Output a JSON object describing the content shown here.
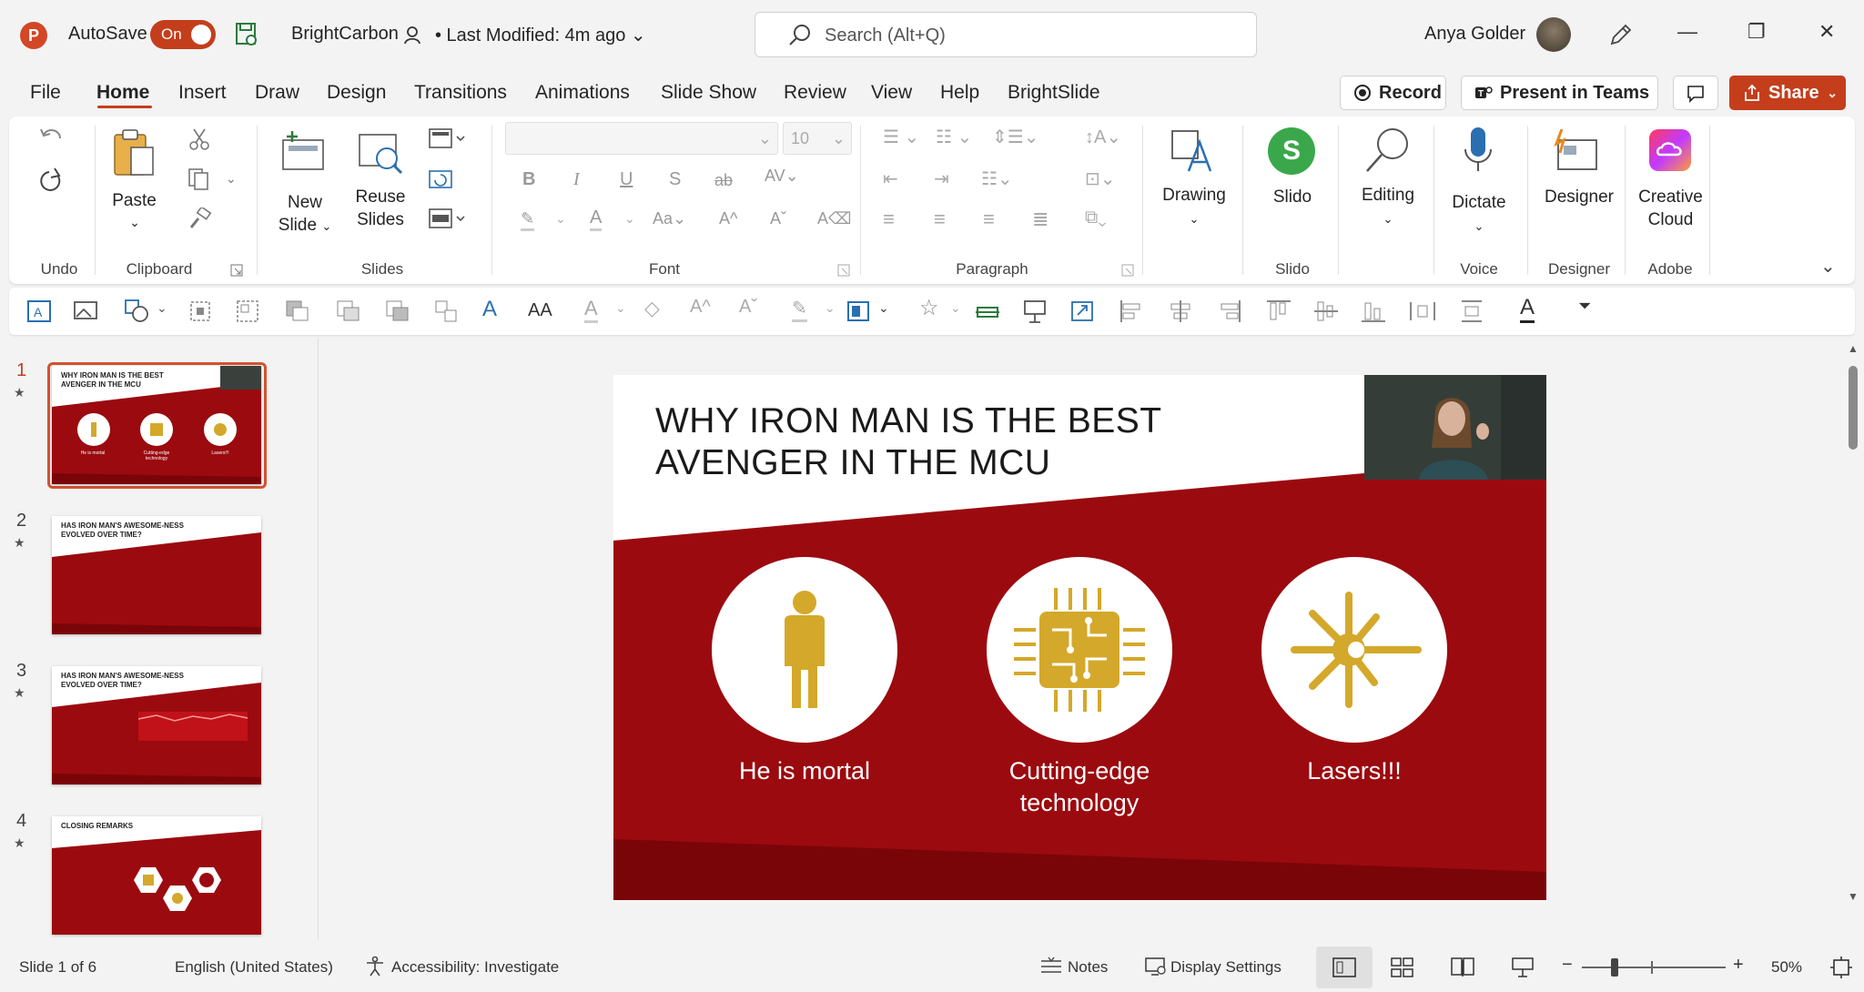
{
  "titlebar": {
    "app_letter": "P",
    "autosave_label": "AutoSave",
    "autosave_state": "On",
    "document_name": "BrightCarbon",
    "modified": "• Last Modified: 4m ago",
    "search_placeholder": "Search (Alt+Q)",
    "user_name": "Anya Golder",
    "minimize": "—",
    "restore": "❐",
    "close": "✕"
  },
  "menu": {
    "tabs": [
      "File",
      "Home",
      "Insert",
      "Draw",
      "Design",
      "Transitions",
      "Animations",
      "Slide Show",
      "Review",
      "View",
      "Help",
      "BrightSlide"
    ],
    "active_tab": "Home",
    "record_label": "Record",
    "present_teams_label": "Present in Teams",
    "share_label": "Share"
  },
  "ribbon": {
    "groups": {
      "undo": "Undo",
      "clipboard": "Clipboard",
      "slides": "Slides",
      "font": "Font",
      "paragraph": "Paragraph",
      "slido": "Slido",
      "voice": "Voice",
      "designer": "Designer",
      "adobe": "Adobe"
    },
    "buttons": {
      "paste": "Paste",
      "new_slide_1": "New",
      "new_slide_2": "Slide",
      "reuse_1": "Reuse",
      "reuse_2": "Slides",
      "font_size": "10",
      "drawing": "Drawing",
      "slido": "Slido",
      "editing": "Editing",
      "dictate": "Dictate",
      "designer": "Designer",
      "creative_1": "Creative",
      "creative_2": "Cloud"
    }
  },
  "thumbnails": [
    {
      "number": "1",
      "title": "WHY IRON MAN IS THE BEST AVENGER IN THE MCU",
      "labels": [
        "He is mortal",
        "Cutting-edge technology",
        "Lasers!!!"
      ]
    },
    {
      "number": "2",
      "title": "HAS IRON MAN'S AWESOME-NESS EVOLVED OVER TIME?"
    },
    {
      "number": "3",
      "title": "HAS IRON MAN'S AWESOME-NESS EVOLVED OVER TIME?"
    },
    {
      "number": "4",
      "title": "CLOSING REMARKS"
    }
  ],
  "slide": {
    "title_line1": "WHY IRON MAN IS THE BEST",
    "title_line2": "AVENGER IN THE MCU",
    "items": [
      {
        "caption": "He is mortal",
        "icon": "person-icon"
      },
      {
        "caption": "Cutting-edge technology",
        "icon": "chip-icon"
      },
      {
        "caption": "Lasers!!!",
        "icon": "laser-icon"
      }
    ]
  },
  "statusbar": {
    "slide_position": "Slide 1 of 6",
    "language": "English (United States)",
    "accessibility": "Accessibility: Investigate",
    "notes": "Notes",
    "display_settings": "Display Settings",
    "zoom": "50%"
  },
  "colors": {
    "brand": "#c43e1c",
    "slide_red": "#9b0a0f",
    "slide_dark_red": "#7a0509",
    "icon_gold": "#d4a82a"
  }
}
